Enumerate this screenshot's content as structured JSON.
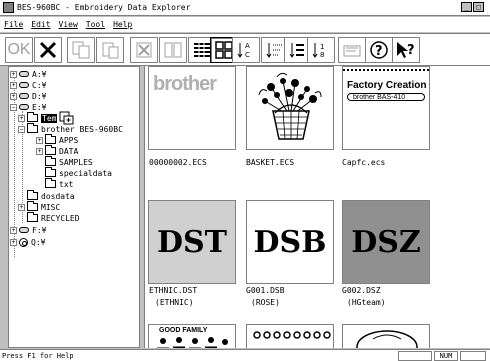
{
  "window": {
    "title": "BES-960BC - Embroidery Data Explorer",
    "min_btn": "_",
    "max_btn": "□"
  },
  "menu": [
    "File",
    "Edit",
    "View",
    "Tool",
    "Help"
  ],
  "toolbar": {
    "ok_label": "OK"
  },
  "tree": {
    "drives": [
      {
        "label": "A:¥",
        "icon": "floppy-drive-icon"
      },
      {
        "label": "C:¥",
        "icon": "hard-drive-icon"
      },
      {
        "label": "D:¥",
        "icon": "hard-drive-icon"
      },
      {
        "label": "E:¥",
        "icon": "hard-drive-icon"
      }
    ],
    "folders": {
      "tem": "Tem",
      "brother": "brother BES-960BC",
      "apps": "APPS",
      "data": "DATA",
      "samples": "SAMPLES",
      "specialdata": "specialdata",
      "txt": "txt",
      "dosdata": "dosdata",
      "misc": "MISC",
      "recycled": "RECYCLED"
    },
    "drive_f": "F:¥",
    "drive_q": "Q:¥"
  },
  "files": {
    "row1": [
      {
        "name": "00000002.ECS",
        "thumb_text": "brother"
      },
      {
        "name": "BASKET.ECS"
      },
      {
        "name": "Capfc.ecs",
        "thumb_text": "Factory Creation",
        "thumb_sub": "brother BAS-410"
      }
    ],
    "row2": [
      {
        "name": "ETHNIC.DST",
        "sub": "(ETHNIC)",
        "thumb_text": "DST"
      },
      {
        "name": "G001.DSB",
        "sub": "(ROSE)",
        "thumb_text": "DSB"
      },
      {
        "name": "G002.DSZ",
        "sub": "(HGteam)",
        "thumb_text": "DSZ"
      }
    ],
    "row3": [
      {
        "thumb_text": "GOOD FAMILY"
      }
    ]
  },
  "status": {
    "text": "Press F1 for Help",
    "num": "NUM"
  }
}
